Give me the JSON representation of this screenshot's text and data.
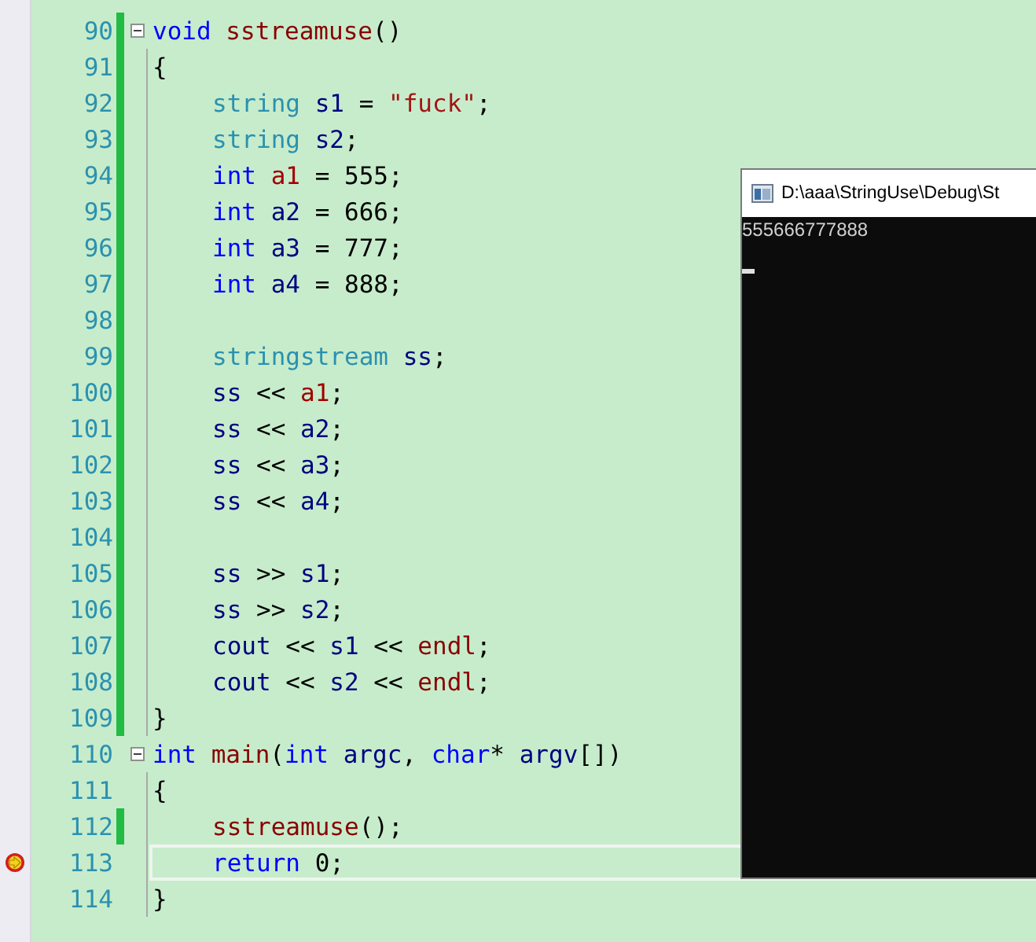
{
  "editor": {
    "lines": [
      {
        "number": "90",
        "changed": true,
        "fold": true,
        "indented": false,
        "current": false,
        "tokens": [
          {
            "kind": "keyword",
            "text": "void "
          },
          {
            "kind": "function",
            "text": "sstreamuse"
          },
          {
            "kind": "plain",
            "text": "()"
          }
        ]
      },
      {
        "number": "91",
        "changed": true,
        "fold": false,
        "indented": false,
        "current": false,
        "tokens": [
          {
            "kind": "plain",
            "text": "{"
          }
        ]
      },
      {
        "number": "92",
        "changed": true,
        "fold": false,
        "indented": true,
        "current": false,
        "tokens": [
          {
            "kind": "type",
            "text": "string "
          },
          {
            "kind": "variable",
            "text": "s1"
          },
          {
            "kind": "plain",
            "text": " = "
          },
          {
            "kind": "string",
            "text": "\"fuck\""
          },
          {
            "kind": "plain",
            "text": ";"
          }
        ]
      },
      {
        "number": "93",
        "changed": true,
        "fold": false,
        "indented": true,
        "current": false,
        "tokens": [
          {
            "kind": "type",
            "text": "string "
          },
          {
            "kind": "variable",
            "text": "s2"
          },
          {
            "kind": "plain",
            "text": ";"
          }
        ]
      },
      {
        "number": "94",
        "changed": true,
        "fold": false,
        "indented": true,
        "current": false,
        "tokens": [
          {
            "kind": "keyword",
            "text": "int "
          },
          {
            "kind": "highlight",
            "text": "a1"
          },
          {
            "kind": "plain",
            "text": " = 555;"
          }
        ]
      },
      {
        "number": "95",
        "changed": true,
        "fold": false,
        "indented": true,
        "current": false,
        "tokens": [
          {
            "kind": "keyword",
            "text": "int "
          },
          {
            "kind": "variable",
            "text": "a2"
          },
          {
            "kind": "plain",
            "text": " = 666;"
          }
        ]
      },
      {
        "number": "96",
        "changed": true,
        "fold": false,
        "indented": true,
        "current": false,
        "tokens": [
          {
            "kind": "keyword",
            "text": "int "
          },
          {
            "kind": "variable",
            "text": "a3"
          },
          {
            "kind": "plain",
            "text": " = 777;"
          }
        ]
      },
      {
        "number": "97",
        "changed": true,
        "fold": false,
        "indented": true,
        "current": false,
        "tokens": [
          {
            "kind": "keyword",
            "text": "int "
          },
          {
            "kind": "variable",
            "text": "a4"
          },
          {
            "kind": "plain",
            "text": " = 888;"
          }
        ]
      },
      {
        "number": "98",
        "changed": true,
        "fold": false,
        "current": false
      },
      {
        "number": "99",
        "changed": true,
        "fold": false,
        "indented": true,
        "current": false,
        "tokens": [
          {
            "kind": "type",
            "text": "stringstream "
          },
          {
            "kind": "variable",
            "text": "ss"
          },
          {
            "kind": "plain",
            "text": ";"
          }
        ]
      },
      {
        "number": "100",
        "changed": true,
        "fold": false,
        "indented": true,
        "current": false,
        "tokens": [
          {
            "kind": "variable",
            "text": "ss"
          },
          {
            "kind": "plain",
            "text": " << "
          },
          {
            "kind": "highlight",
            "text": "a1"
          },
          {
            "kind": "plain",
            "text": ";"
          }
        ]
      },
      {
        "number": "101",
        "changed": true,
        "fold": false,
        "indented": true,
        "current": false,
        "tokens": [
          {
            "kind": "variable",
            "text": "ss"
          },
          {
            "kind": "plain",
            "text": " << "
          },
          {
            "kind": "variable",
            "text": "a2"
          },
          {
            "kind": "plain",
            "text": ";"
          }
        ]
      },
      {
        "number": "102",
        "changed": true,
        "fold": false,
        "indented": true,
        "current": false,
        "tokens": [
          {
            "kind": "variable",
            "text": "ss"
          },
          {
            "kind": "plain",
            "text": " << "
          },
          {
            "kind": "variable",
            "text": "a3"
          },
          {
            "kind": "plain",
            "text": ";"
          }
        ]
      },
      {
        "number": "103",
        "changed": true,
        "fold": false,
        "indented": true,
        "current": false,
        "tokens": [
          {
            "kind": "variable",
            "text": "ss"
          },
          {
            "kind": "plain",
            "text": " << "
          },
          {
            "kind": "variable",
            "text": "a4"
          },
          {
            "kind": "plain",
            "text": ";"
          }
        ]
      },
      {
        "number": "104",
        "changed": true,
        "fold": false,
        "current": false
      },
      {
        "number": "105",
        "changed": true,
        "fold": false,
        "indented": true,
        "current": false,
        "tokens": [
          {
            "kind": "variable",
            "text": "ss"
          },
          {
            "kind": "plain",
            "text": " >> "
          },
          {
            "kind": "variable",
            "text": "s1"
          },
          {
            "kind": "plain",
            "text": ";"
          }
        ]
      },
      {
        "number": "106",
        "changed": true,
        "fold": false,
        "indented": true,
        "current": false,
        "tokens": [
          {
            "kind": "variable",
            "text": "ss"
          },
          {
            "kind": "plain",
            "text": " >> "
          },
          {
            "kind": "variable",
            "text": "s2"
          },
          {
            "kind": "plain",
            "text": ";"
          }
        ]
      },
      {
        "number": "107",
        "changed": true,
        "fold": false,
        "indented": true,
        "current": false,
        "tokens": [
          {
            "kind": "variable",
            "text": "cout"
          },
          {
            "kind": "plain",
            "text": " << "
          },
          {
            "kind": "variable",
            "text": "s1"
          },
          {
            "kind": "plain",
            "text": " << "
          },
          {
            "kind": "function",
            "text": "endl"
          },
          {
            "kind": "plain",
            "text": ";"
          }
        ]
      },
      {
        "number": "108",
        "changed": true,
        "fold": false,
        "indented": true,
        "current": false,
        "tokens": [
          {
            "kind": "variable",
            "text": "cout"
          },
          {
            "kind": "plain",
            "text": " << "
          },
          {
            "kind": "variable",
            "text": "s2"
          },
          {
            "kind": "plain",
            "text": " << "
          },
          {
            "kind": "function",
            "text": "endl"
          },
          {
            "kind": "plain",
            "text": ";"
          }
        ]
      },
      {
        "number": "109",
        "changed": true,
        "fold": false,
        "indented": false,
        "current": false,
        "tokens": [
          {
            "kind": "plain",
            "text": "}"
          }
        ]
      },
      {
        "number": "110",
        "changed": false,
        "fold": true,
        "indented": false,
        "current": false,
        "tokens": [
          {
            "kind": "keyword",
            "text": "int "
          },
          {
            "kind": "function",
            "text": "main"
          },
          {
            "kind": "plain",
            "text": "("
          },
          {
            "kind": "keyword",
            "text": "int "
          },
          {
            "kind": "variable",
            "text": "argc"
          },
          {
            "kind": "plain",
            "text": ", "
          },
          {
            "kind": "keyword",
            "text": "char"
          },
          {
            "kind": "plain",
            "text": "* "
          },
          {
            "kind": "variable",
            "text": "argv"
          },
          {
            "kind": "plain",
            "text": "[])"
          }
        ]
      },
      {
        "number": "111",
        "changed": false,
        "fold": false,
        "indented": false,
        "current": false,
        "tokens": [
          {
            "kind": "plain",
            "text": "{"
          }
        ]
      },
      {
        "number": "112",
        "changed": true,
        "fold": false,
        "indented": true,
        "current": false,
        "tokens": [
          {
            "kind": "function",
            "text": "sstreamuse"
          },
          {
            "kind": "plain",
            "text": "();"
          }
        ]
      },
      {
        "number": "113",
        "changed": false,
        "fold": false,
        "indented": true,
        "current": true,
        "tokens": [
          {
            "kind": "keyword",
            "text": "return "
          },
          {
            "kind": "plain",
            "text": "0;"
          }
        ]
      },
      {
        "number": "114",
        "changed": false,
        "fold": false,
        "indented": false,
        "current": false,
        "tokens": [
          {
            "kind": "plain",
            "text": "}"
          }
        ]
      }
    ]
  },
  "console": {
    "title": "D:\\aaa\\StringUse\\Debug\\St",
    "output": "555666777888"
  }
}
